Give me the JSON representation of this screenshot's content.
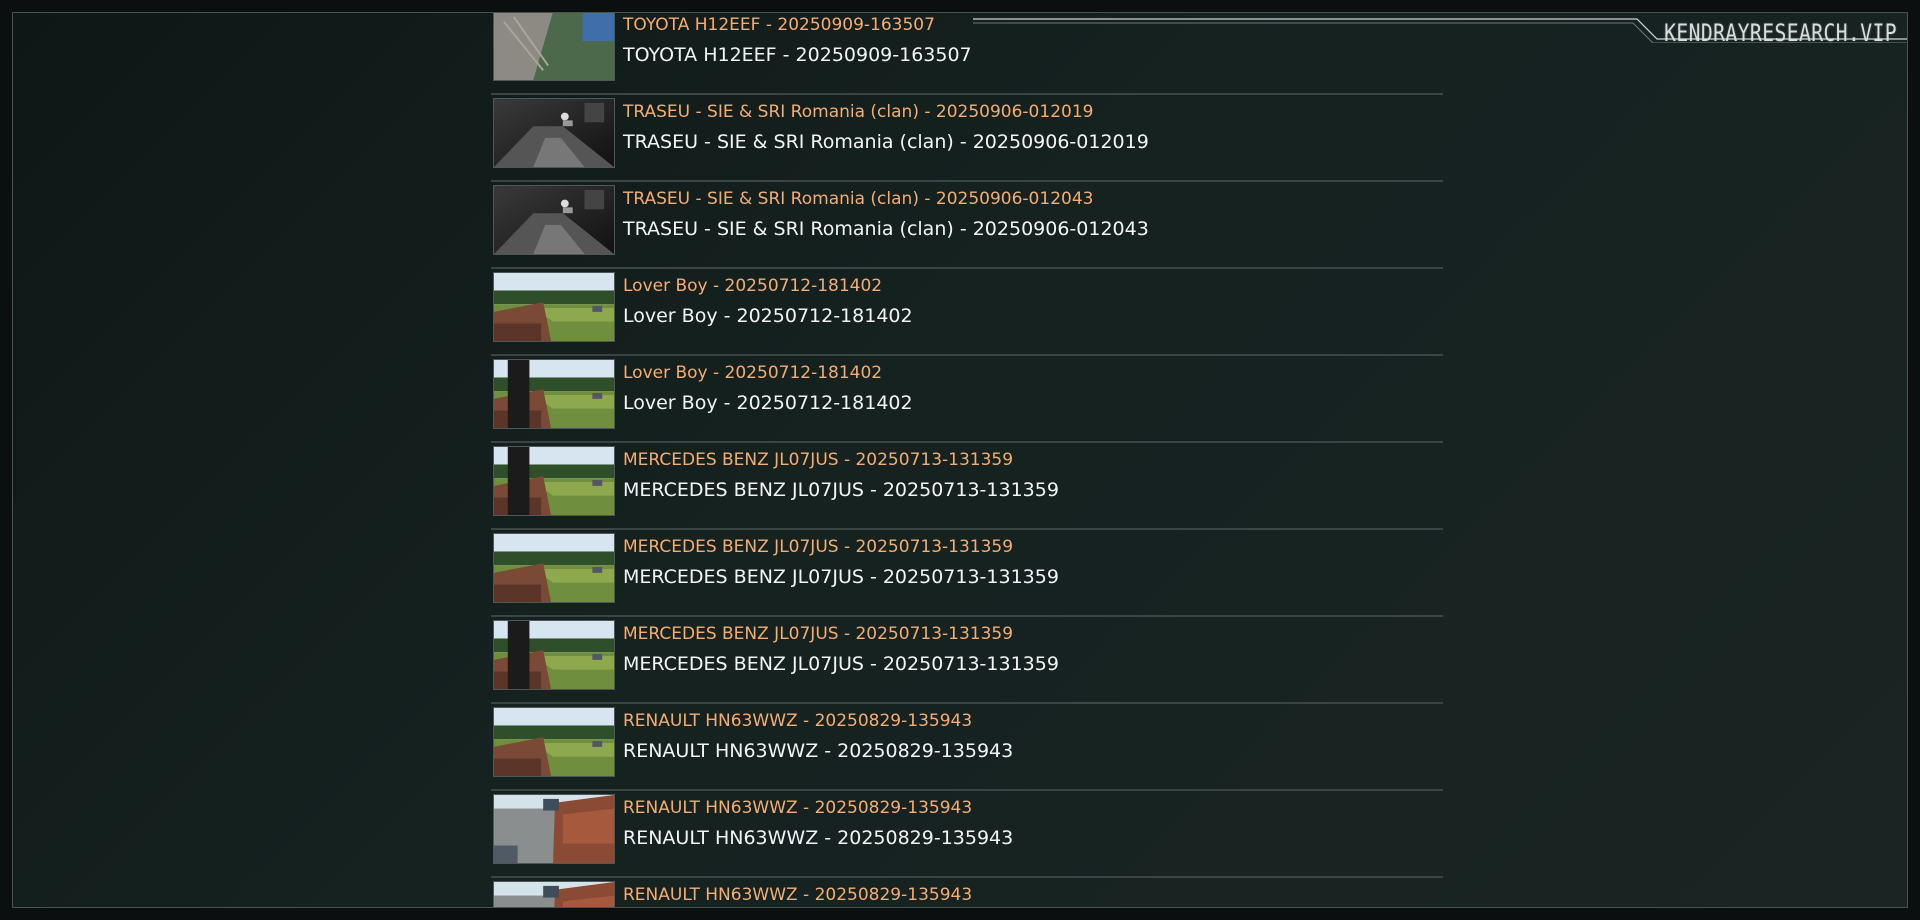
{
  "brand": {
    "label": "KENDRAYRESEARCH.VIP"
  },
  "items": [
    {
      "title": "TOYOTA H12EEF - 20250909-163507",
      "subtitle": "TOYOTA H12EEF - 20250909-163507",
      "thumb": "day-alley"
    },
    {
      "title": "TRASEU - SIE & SRI Romania (clan) - 20250906-012019",
      "subtitle": "TRASEU - SIE & SRI Romania (clan) - 20250906-012019",
      "thumb": "night-street"
    },
    {
      "title": "TRASEU - SIE & SRI Romania (clan) - 20250906-012043",
      "subtitle": "TRASEU - SIE & SRI Romania (clan) - 20250906-012043",
      "thumb": "night-street"
    },
    {
      "title": "Lover Boy - 20250712-181402",
      "subtitle": "Lover Boy - 20250712-181402",
      "thumb": "day-garden"
    },
    {
      "title": "Lover Boy - 20250712-181402",
      "subtitle": "Lover Boy - 20250712-181402",
      "thumb": "day-garden-dark"
    },
    {
      "title": "MERCEDES BENZ JL07JUS - 20250713-131359",
      "subtitle": "MERCEDES BENZ JL07JUS - 20250713-131359",
      "thumb": "day-garden-dark"
    },
    {
      "title": "MERCEDES BENZ JL07JUS - 20250713-131359",
      "subtitle": "MERCEDES BENZ JL07JUS - 20250713-131359",
      "thumb": "day-garden"
    },
    {
      "title": "MERCEDES BENZ JL07JUS - 20250713-131359",
      "subtitle": "MERCEDES BENZ JL07JUS - 20250713-131359",
      "thumb": "day-garden-dark"
    },
    {
      "title": "RENAULT HN63WWZ - 20250829-135943",
      "subtitle": "RENAULT HN63WWZ - 20250829-135943",
      "thumb": "day-garden"
    },
    {
      "title": "RENAULT HN63WWZ - 20250829-135943",
      "subtitle": "RENAULT HN63WWZ - 20250829-135943",
      "thumb": "day-driveway"
    },
    {
      "title": "RENAULT HN63WWZ - 20250829-135943",
      "subtitle": "",
      "thumb": "day-driveway"
    }
  ],
  "colors": {
    "title": "#f4ad73",
    "subtitle": "#f3f5f5",
    "border": "#3a4444"
  }
}
